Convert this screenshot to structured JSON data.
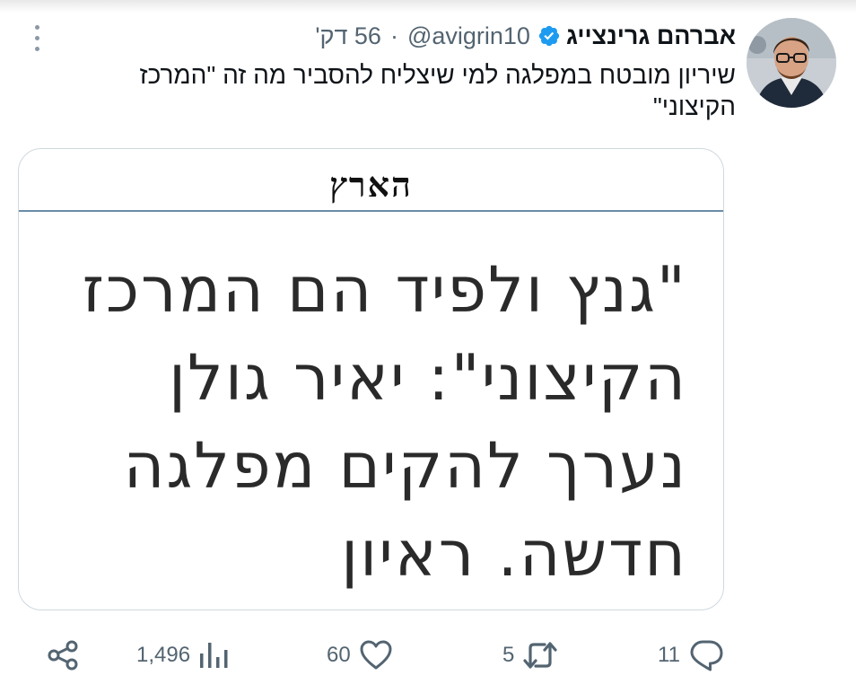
{
  "tweet": {
    "display_name": "אברהם גרינצייג",
    "handle": "@avigrin10",
    "separator": "·",
    "time": "56 דק'",
    "text": "שיריון מובטח במפלגה למי שיצליח להסביר מה זה \"המרכז הקיצוני\"",
    "verified_color": "#1d9bf0"
  },
  "media": {
    "masthead": "הארץ",
    "headline": "\"גנץ ולפיד הם המרכז הקיצוני\": יאיר גולן נערך להקים מפלגה חדשה. ראיון"
  },
  "actions": {
    "reply_count": "11",
    "retweet_count": "5",
    "like_count": "60",
    "views_count": "1,496"
  }
}
